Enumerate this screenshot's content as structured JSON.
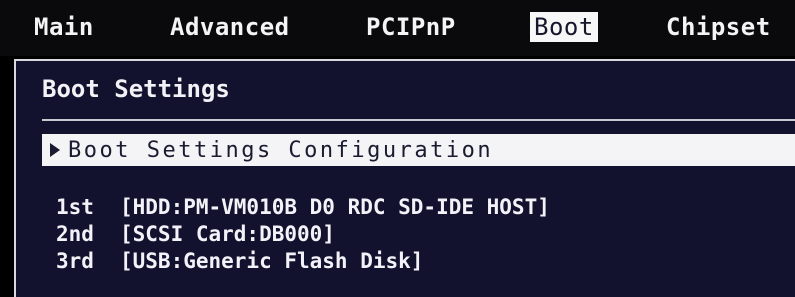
{
  "menu": {
    "tabs": [
      {
        "label": "Main"
      },
      {
        "label": "Advanced"
      },
      {
        "label": "PCIPnP"
      },
      {
        "label": "Boot",
        "active": true
      },
      {
        "label": "Chipset"
      }
    ]
  },
  "panel": {
    "title": "Boot Settings",
    "selected_item": "Boot Settings Configuration",
    "boot_devices": [
      {
        "order": "1st",
        "device": "[HDD:PM-VM010B D0 RDC SD-IDE HOST]"
      },
      {
        "order": "2nd",
        "device": "[SCSI Card:DB000]"
      },
      {
        "order": "3rd",
        "device": "[USB:Generic Flash Disk]"
      }
    ]
  },
  "colors": {
    "panel_background": "#12112e",
    "menu_background": "#0a0a0c",
    "highlight": "#f4f4f6",
    "text": "#f2f2f8"
  }
}
